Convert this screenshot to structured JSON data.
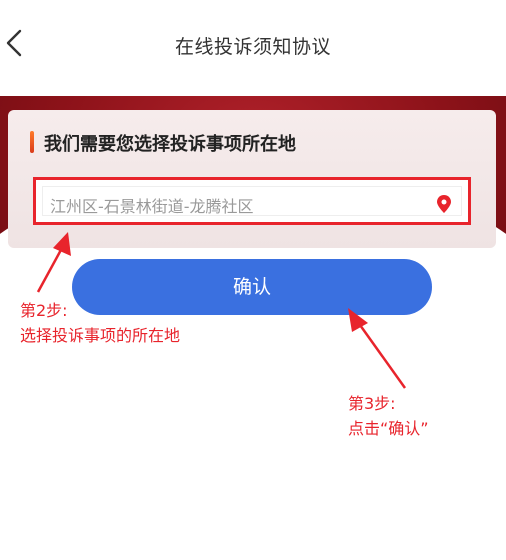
{
  "nav": {
    "title": "在线投诉须知协议"
  },
  "card": {
    "title": "我们需要您选择投诉事项所在地",
    "location_value": "江州区-石景林街道-龙腾社区"
  },
  "confirm_label": "确认",
  "annotations": {
    "step2_label": "第2步:",
    "step2_text": "选择投诉事项的所在地",
    "step3_label": "第3步:",
    "step3_text": "点击“确认”"
  },
  "colors": {
    "accent_red": "#e8242c",
    "button_blue": "#3a70e0",
    "banner_red": "#8c1219"
  },
  "icons": [
    "chevron-left-icon",
    "location-pin-icon"
  ]
}
